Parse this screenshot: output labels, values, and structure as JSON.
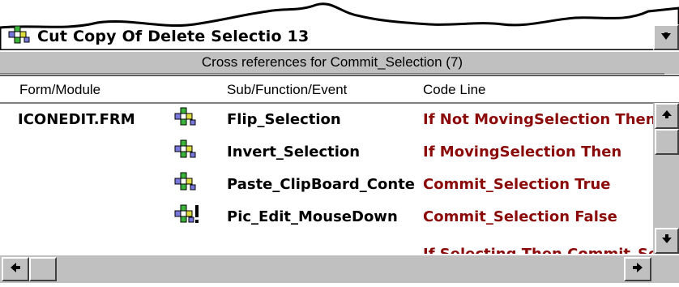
{
  "previous_row": {
    "text": "Cut Copy Of Delete Selectio 13"
  },
  "window": {
    "title": "Cross references for Commit_Selection (7)"
  },
  "columns": [
    "Form/Module",
    "Sub/Function/Event",
    "Code Line"
  ],
  "rows": [
    {
      "form": "ICONEDIT.FRM",
      "icon": "procedure-icon",
      "sub": "Flip_Selection",
      "code": "If Not MovingSelection Then"
    },
    {
      "form": "",
      "icon": "procedure-icon",
      "sub": "Invert_Selection",
      "code": "If MovingSelection Then"
    },
    {
      "form": "",
      "icon": "procedure-icon",
      "sub": "Paste_ClipBoard_Contents",
      "code": "Commit_Selection True"
    },
    {
      "form": "",
      "icon": "procedure-warning-icon",
      "sub": "Pic_Edit_MouseDown",
      "code": "Commit_Selection False"
    },
    {
      "form": "",
      "icon": "",
      "sub": "",
      "code": "If Selecting Then Commit_Selection"
    }
  ],
  "colors": {
    "code_text": "#8b0a0a",
    "face": "#c0c0c0",
    "highlight": "#ffffff",
    "shadow": "#808080"
  }
}
